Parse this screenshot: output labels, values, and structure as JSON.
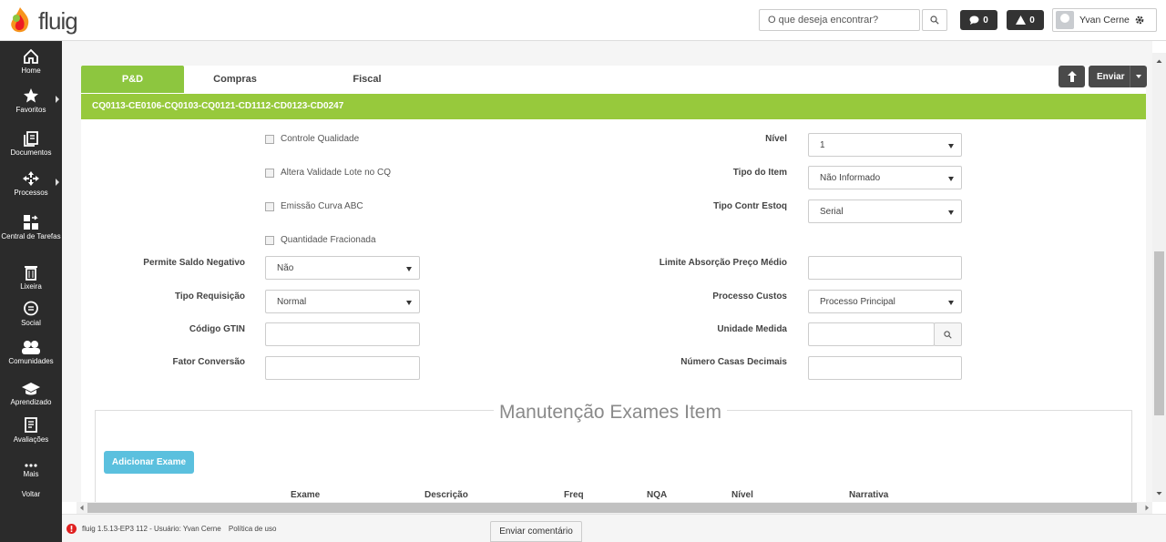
{
  "topbar": {
    "logo_text": "fluig",
    "search_placeholder": "O que deseja encontrar?",
    "messages_count": "0",
    "alerts_count": "0",
    "user_name": "Yvan Cerne"
  },
  "sidebar": {
    "items": [
      {
        "label": "Home",
        "icon": "home-icon"
      },
      {
        "label": "Favoritos",
        "icon": "star-icon"
      },
      {
        "label": "Documentos",
        "icon": "documents-icon"
      },
      {
        "label": "Processos",
        "icon": "processes-icon"
      },
      {
        "label": "Central de Tarefas",
        "icon": "tasks-icon"
      },
      {
        "label": "Lixeira",
        "icon": "trash-icon"
      },
      {
        "label": "Social",
        "icon": "social-icon"
      },
      {
        "label": "Comunidades",
        "icon": "communities-icon"
      },
      {
        "label": "Aprendizado",
        "icon": "learning-icon"
      },
      {
        "label": "Avaliações",
        "icon": "evaluations-icon"
      },
      {
        "label": "Mais",
        "icon": "more-icon"
      },
      {
        "label": "Voltar"
      }
    ]
  },
  "tabs": [
    "P&D",
    "Compras",
    "Fiscal"
  ],
  "toolbar": {
    "send_label": "Enviar"
  },
  "header_code": "CQ0113-CE0106-CQ0103-CQ0121-CD1112-CD0123-CD0247",
  "checkboxes": [
    "Controle Qualidade",
    "Altera Validade Lote no CQ",
    "Emissão Curva ABC",
    "Quantidade Fracionada"
  ],
  "fields": {
    "nivel": {
      "label": "Nível",
      "value": "1"
    },
    "tipo_item": {
      "label": "Tipo do Item",
      "value": "Não Informado"
    },
    "tipo_contr": {
      "label": "Tipo Contr Estoq",
      "value": "Serial"
    },
    "permite_saldo": {
      "label": "Permite Saldo Negativo",
      "value": "Não"
    },
    "limite_absorcao": {
      "label": "Limite Absorção Preço Médio"
    },
    "tipo_requisicao": {
      "label": "Tipo Requisição",
      "value": "Normal"
    },
    "processo_custos": {
      "label": "Processo Custos",
      "value": "Processo Principal"
    },
    "codigo_gtin": {
      "label": "Código GTIN"
    },
    "unidade_medida": {
      "label": "Unidade Medida"
    },
    "fator_conversao": {
      "label": "Fator Conversão"
    },
    "numero_casas": {
      "label": "Número Casas Decimais"
    }
  },
  "exams": {
    "title": "Manutenção Exames Item",
    "add_label": "Adicionar Exame",
    "columns": [
      "Exame",
      "Descrição",
      "Freq",
      "NQA",
      "Nível",
      "Narrativa"
    ]
  },
  "footer": {
    "version_text": "fluig 1.5.13-EP3 112 - Usuário: Yvan Cerne",
    "policy_link": "Política de uso",
    "comment_label": "Enviar comentário"
  }
}
